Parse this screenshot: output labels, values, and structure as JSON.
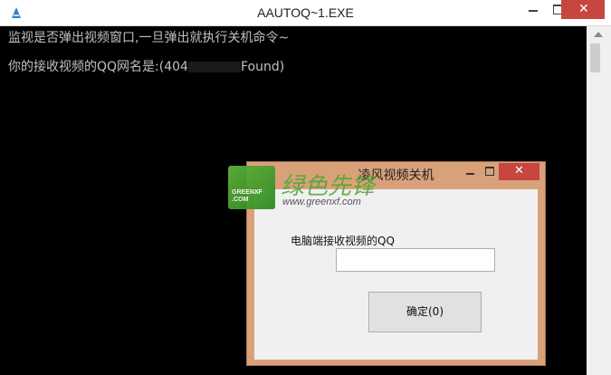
{
  "console": {
    "title": "AAUTOQ~1.EXE",
    "line1": "监视是否弹出视频窗口,一旦弹出就执行关机命令~",
    "line2_prefix": "你的接收视频的QQ网名是:(404",
    "line2_suffix": "Found)",
    "close_glyph": "✕"
  },
  "watermark": {
    "main": "绿色先锋",
    "url": "www.greenxf.com",
    "logo_text": "GREENXF .COM"
  },
  "dialog": {
    "title": "凌风视频关机",
    "qq_label": "电脑端接收视频的QQ",
    "qq_value": "",
    "ok_label": "确定(0)",
    "close_glyph": "✕"
  },
  "colors": {
    "dialog_frame": "#d9a17a",
    "close_red": "#c7463f",
    "console_bg": "#000000"
  }
}
